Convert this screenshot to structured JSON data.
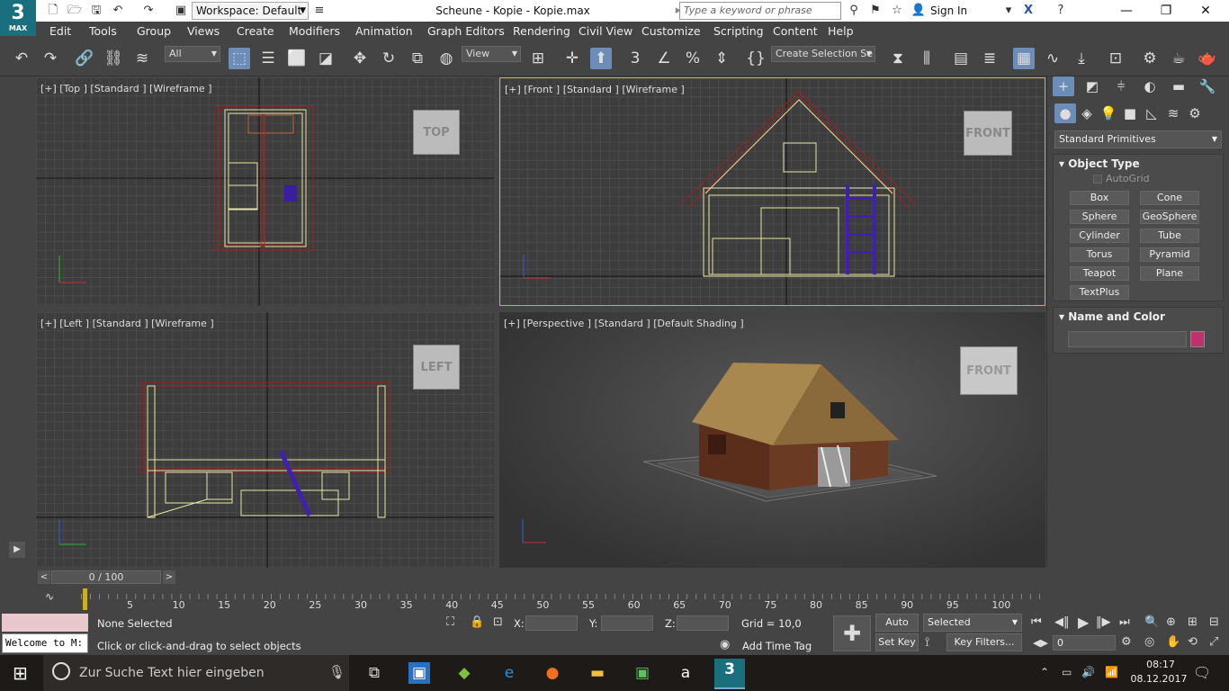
{
  "titlebar": {
    "app_icon_main": "3",
    "app_icon_sub": "MAX",
    "workspace": "Workspace: Default",
    "document_title": "Scheune - Kopie - Kopie.max",
    "search_placeholder": "Type a keyword or phrase",
    "sign_in": "Sign In"
  },
  "menu": [
    "Edit",
    "Tools",
    "Group",
    "Views",
    "Create",
    "Modifiers",
    "Animation",
    "Graph Editors",
    "Rendering",
    "Civil View",
    "Customize",
    "Scripting",
    "Content",
    "Help"
  ],
  "toolbar": {
    "filter_value": "All",
    "refcoord_value": "View",
    "selection_set_placeholder": "Create Selection Se"
  },
  "viewports": {
    "top": {
      "label": "[+] [Top ] [Standard ] [Wireframe ]",
      "cube": "TOP"
    },
    "front": {
      "label": "[+] [Front ] [Standard ] [Wireframe ]",
      "cube": "FRONT"
    },
    "left": {
      "label": "[+] [Left ] [Standard ] [Wireframe ]",
      "cube": "LEFT"
    },
    "perspective": {
      "label": "[+] [Perspective ] [Standard ] [Default Shading ]",
      "cube": "FRONT"
    }
  },
  "command_panel": {
    "primitives_dropdown": "Standard Primitives",
    "object_type_title": "Object Type",
    "autogrid_label": "AutoGrid",
    "buttons": [
      "Box",
      "Cone",
      "Sphere",
      "GeoSphere",
      "Cylinder",
      "Tube",
      "Torus",
      "Pyramid",
      "Teapot",
      "Plane",
      "TextPlus"
    ],
    "name_color_title": "Name and Color",
    "object_color": "#c0306a"
  },
  "timeline": {
    "frame_display": "0 / 100",
    "ticks": [
      "5",
      "10",
      "15",
      "20",
      "25",
      "30",
      "35",
      "40",
      "45",
      "50",
      "55",
      "60",
      "65",
      "70",
      "75",
      "80",
      "85",
      "90",
      "95",
      "100"
    ]
  },
  "status": {
    "maxscript_text": "Welcome to M:",
    "selection_info": "None Selected",
    "prompt": "Click or click-and-drag to select objects",
    "x_label": "X:",
    "y_label": "Y:",
    "z_label": "Z:",
    "grid": "Grid = 10,0",
    "add_time_tag": "Add Time Tag",
    "auto_key": "Auto Key",
    "selected_dropdown": "Selected",
    "set_key": "Set Key",
    "key_filters": "Key Filters...",
    "frame_value": "0"
  },
  "taskbar": {
    "search_placeholder": "Zur Suche Text hier eingeben",
    "time": "08:17",
    "date": "08.12.2017"
  }
}
